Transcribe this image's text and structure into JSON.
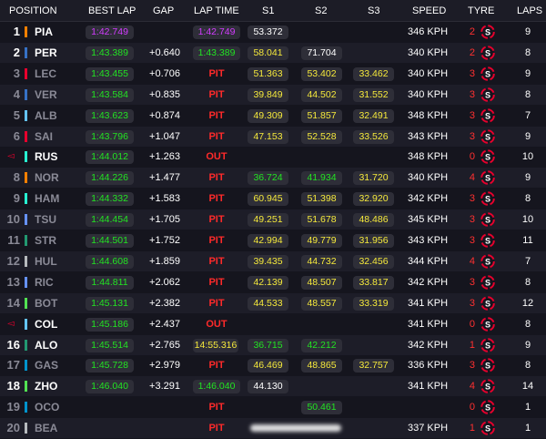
{
  "header": {
    "position": "POSITION",
    "best_lap": "BEST LAP",
    "gap": "GAP",
    "lap_time": "LAP TIME",
    "s1": "S1",
    "s2": "S2",
    "s3": "S3",
    "speed": "SPEED",
    "tyre": "TYRE",
    "laps": "LAPS"
  },
  "colors": {
    "green": "#22e322",
    "purple": "#d33cff",
    "yellow": "#f5e93b",
    "red": "#ff2a2a",
    "tyre_soft": "#e8002d"
  },
  "rows": [
    {
      "pos": "1",
      "abbr": "PIA",
      "team_color": "#ff8000",
      "best": "1:42.749",
      "best_c": "purple",
      "gap": "",
      "lap": "1:42.749",
      "lap_c": "purple",
      "lap_pill": true,
      "s1": "53.372",
      "s1_c": "white",
      "s2": "",
      "s2_c": "white",
      "s3": "",
      "s3_c": "white",
      "speed": "346 KPH",
      "tyre_n": "2",
      "tyre": "S",
      "laps": "9",
      "dim": false
    },
    {
      "pos": "2",
      "abbr": "PER",
      "team_color": "#3671c6",
      "best": "1:43.389",
      "best_c": "green",
      "gap": "+0.640",
      "lap": "1:43.389",
      "lap_c": "green",
      "lap_pill": true,
      "s1": "58.041",
      "s1_c": "yellow",
      "s2": "71.704",
      "s2_c": "white",
      "s3": "",
      "s3_c": "white",
      "speed": "340 KPH",
      "tyre_n": "2",
      "tyre": "S",
      "laps": "8",
      "dim": false
    },
    {
      "pos": "3",
      "abbr": "LEC",
      "team_color": "#e8002d",
      "best": "1:43.455",
      "best_c": "green",
      "gap": "+0.706",
      "lap": "PIT",
      "lap_c": "red",
      "lap_pill": false,
      "s1": "51.363",
      "s1_c": "yellow",
      "s2": "53.402",
      "s2_c": "yellow",
      "s3": "33.462",
      "s3_c": "yellow",
      "speed": "340 KPH",
      "tyre_n": "3",
      "tyre": "S",
      "laps": "9",
      "dim": true
    },
    {
      "pos": "4",
      "abbr": "VER",
      "team_color": "#3671c6",
      "best": "1:43.584",
      "best_c": "green",
      "gap": "+0.835",
      "lap": "PIT",
      "lap_c": "red",
      "lap_pill": false,
      "s1": "39.849",
      "s1_c": "yellow",
      "s2": "44.502",
      "s2_c": "yellow",
      "s3": "31.552",
      "s3_c": "yellow",
      "speed": "340 KPH",
      "tyre_n": "3",
      "tyre": "S",
      "laps": "8",
      "dim": true
    },
    {
      "pos": "5",
      "abbr": "ALB",
      "team_color": "#64c4ff",
      "best": "1:43.623",
      "best_c": "green",
      "gap": "+0.874",
      "lap": "PIT",
      "lap_c": "red",
      "lap_pill": false,
      "s1": "49.309",
      "s1_c": "yellow",
      "s2": "51.857",
      "s2_c": "yellow",
      "s3": "32.491",
      "s3_c": "yellow",
      "speed": "348 KPH",
      "tyre_n": "3",
      "tyre": "S",
      "laps": "7",
      "dim": true
    },
    {
      "pos": "6",
      "abbr": "SAI",
      "team_color": "#e8002d",
      "best": "1:43.796",
      "best_c": "green",
      "gap": "+1.047",
      "lap": "PIT",
      "lap_c": "red",
      "lap_pill": false,
      "s1": "47.153",
      "s1_c": "yellow",
      "s2": "52.528",
      "s2_c": "yellow",
      "s3": "33.526",
      "s3_c": "yellow",
      "speed": "343 KPH",
      "tyre_n": "3",
      "tyre": "S",
      "laps": "9",
      "dim": true
    },
    {
      "pos": "",
      "flag": "◅",
      "abbr": "RUS",
      "team_color": "#27f4d2",
      "best": "1:44.012",
      "best_c": "green",
      "gap": "+1.263",
      "lap": "OUT",
      "lap_c": "red",
      "lap_pill": false,
      "s1": "",
      "s1_c": "white",
      "s2": "",
      "s2_c": "white",
      "s3": "",
      "s3_c": "white",
      "speed": "348 KPH",
      "tyre_n": "0",
      "tyre": "S",
      "laps": "10",
      "dim": false
    },
    {
      "pos": "8",
      "abbr": "NOR",
      "team_color": "#ff8000",
      "best": "1:44.226",
      "best_c": "green",
      "gap": "+1.477",
      "lap": "PIT",
      "lap_c": "red",
      "lap_pill": false,
      "s1": "36.724",
      "s1_c": "green",
      "s2": "41.934",
      "s2_c": "green",
      "s3": "31.720",
      "s3_c": "yellow",
      "speed": "340 KPH",
      "tyre_n": "4",
      "tyre": "S",
      "laps": "9",
      "dim": true
    },
    {
      "pos": "9",
      "abbr": "HAM",
      "team_color": "#27f4d2",
      "best": "1:44.332",
      "best_c": "green",
      "gap": "+1.583",
      "lap": "PIT",
      "lap_c": "red",
      "lap_pill": false,
      "s1": "60.945",
      "s1_c": "yellow",
      "s2": "51.398",
      "s2_c": "yellow",
      "s3": "32.920",
      "s3_c": "yellow",
      "speed": "342 KPH",
      "tyre_n": "3",
      "tyre": "S",
      "laps": "8",
      "dim": true
    },
    {
      "pos": "10",
      "abbr": "TSU",
      "team_color": "#6692ff",
      "best": "1:44.454",
      "best_c": "green",
      "gap": "+1.705",
      "lap": "PIT",
      "lap_c": "red",
      "lap_pill": false,
      "s1": "49.251",
      "s1_c": "yellow",
      "s2": "51.678",
      "s2_c": "yellow",
      "s3": "48.486",
      "s3_c": "yellow",
      "speed": "345 KPH",
      "tyre_n": "3",
      "tyre": "S",
      "laps": "10",
      "dim": true
    },
    {
      "pos": "11",
      "abbr": "STR",
      "team_color": "#229971",
      "best": "1:44.501",
      "best_c": "green",
      "gap": "+1.752",
      "lap": "PIT",
      "lap_c": "red",
      "lap_pill": false,
      "s1": "42.994",
      "s1_c": "yellow",
      "s2": "49.779",
      "s2_c": "yellow",
      "s3": "31.956",
      "s3_c": "yellow",
      "speed": "343 KPH",
      "tyre_n": "3",
      "tyre": "S",
      "laps": "11",
      "dim": true
    },
    {
      "pos": "12",
      "abbr": "HUL",
      "team_color": "#b6babd",
      "best": "1:44.608",
      "best_c": "green",
      "gap": "+1.859",
      "lap": "PIT",
      "lap_c": "red",
      "lap_pill": false,
      "s1": "39.435",
      "s1_c": "yellow",
      "s2": "44.732",
      "s2_c": "yellow",
      "s3": "32.456",
      "s3_c": "yellow",
      "speed": "344 KPH",
      "tyre_n": "4",
      "tyre": "S",
      "laps": "7",
      "dim": true
    },
    {
      "pos": "13",
      "abbr": "RIC",
      "team_color": "#6692ff",
      "best": "1:44.811",
      "best_c": "green",
      "gap": "+2.062",
      "lap": "PIT",
      "lap_c": "red",
      "lap_pill": false,
      "s1": "42.139",
      "s1_c": "yellow",
      "s2": "48.507",
      "s2_c": "yellow",
      "s3": "33.817",
      "s3_c": "yellow",
      "speed": "342 KPH",
      "tyre_n": "3",
      "tyre": "S",
      "laps": "8",
      "dim": true
    },
    {
      "pos": "14",
      "abbr": "BOT",
      "team_color": "#52e252",
      "best": "1:45.131",
      "best_c": "green",
      "gap": "+2.382",
      "lap": "PIT",
      "lap_c": "red",
      "lap_pill": false,
      "s1": "44.533",
      "s1_c": "yellow",
      "s2": "48.557",
      "s2_c": "yellow",
      "s3": "33.319",
      "s3_c": "yellow",
      "speed": "341 KPH",
      "tyre_n": "3",
      "tyre": "S",
      "laps": "12",
      "dim": true
    },
    {
      "pos": "",
      "flag": "◅",
      "abbr": "COL",
      "team_color": "#64c4ff",
      "best": "1:45.186",
      "best_c": "green",
      "gap": "+2.437",
      "lap": "OUT",
      "lap_c": "red",
      "lap_pill": false,
      "s1": "",
      "s1_c": "white",
      "s2": "",
      "s2_c": "white",
      "s3": "",
      "s3_c": "white",
      "speed": "341 KPH",
      "tyre_n": "0",
      "tyre": "S",
      "laps": "8",
      "dim": false
    },
    {
      "pos": "16",
      "abbr": "ALO",
      "team_color": "#229971",
      "best": "1:45.514",
      "best_c": "green",
      "gap": "+2.765",
      "lap": "14:55.316",
      "lap_c": "yellow",
      "lap_pill": true,
      "s1": "36.715",
      "s1_c": "green",
      "s2": "42.212",
      "s2_c": "green",
      "s3": "",
      "s3_c": "white",
      "speed": "342 KPH",
      "tyre_n": "1",
      "tyre": "S",
      "laps": "9",
      "dim": false
    },
    {
      "pos": "17",
      "abbr": "GAS",
      "team_color": "#0093cc",
      "best": "1:45.728",
      "best_c": "green",
      "gap": "+2.979",
      "lap": "PIT",
      "lap_c": "red",
      "lap_pill": false,
      "s1": "46.469",
      "s1_c": "yellow",
      "s2": "48.865",
      "s2_c": "yellow",
      "s3": "32.757",
      "s3_c": "yellow",
      "speed": "336 KPH",
      "tyre_n": "3",
      "tyre": "S",
      "laps": "8",
      "dim": true
    },
    {
      "pos": "18",
      "abbr": "ZHO",
      "team_color": "#52e252",
      "best": "1:46.040",
      "best_c": "green",
      "gap": "+3.291",
      "lap": "1:46.040",
      "lap_c": "green",
      "lap_pill": true,
      "s1": "44.130",
      "s1_c": "white",
      "s2": "",
      "s2_c": "white",
      "s3": "",
      "s3_c": "white",
      "speed": "341 KPH",
      "tyre_n": "4",
      "tyre": "S",
      "laps": "14",
      "dim": false
    },
    {
      "pos": "19",
      "abbr": "OCO",
      "team_color": "#0093cc",
      "best": "",
      "best_c": "green",
      "gap": "",
      "lap": "PIT",
      "lap_c": "red",
      "lap_pill": false,
      "s1": "",
      "s1_c": "white",
      "s2": "50.461",
      "s2_c": "green",
      "s3": "",
      "s3_c": "white",
      "speed": "",
      "tyre_n": "0",
      "tyre": "S",
      "laps": "1",
      "dim": true
    },
    {
      "pos": "20",
      "abbr": "BEA",
      "team_color": "#b6babd",
      "best": "",
      "best_c": "green",
      "gap": "",
      "lap": "PIT",
      "lap_c": "red",
      "lap_pill": false,
      "s1": "",
      "s1_c": "white",
      "s2": "",
      "s2_c": "white",
      "s3": "",
      "s3_c": "white",
      "speed": "337 KPH",
      "tyre_n": "1",
      "tyre": "S",
      "laps": "1",
      "dim": true,
      "blurred": true
    }
  ]
}
